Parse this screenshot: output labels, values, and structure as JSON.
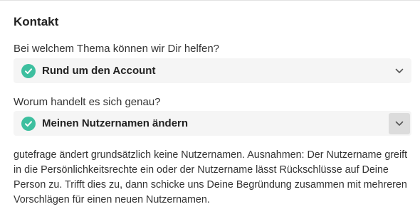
{
  "contact": {
    "title": "Kontakt",
    "topic_label": "Bei welchem Thema können wir Dir helfen?",
    "topic_value": "Rund um den Account",
    "detail_label": "Worum handelt es sich genau?",
    "detail_value": "Meinen Nutzernamen ändern",
    "description": "gutefrage ändert grundsätzlich keine Nutzernamen. Ausnahmen: Der Nutzername greift in die Persönlichkeitsrechte ein oder der Nutzername lässt Rückschlüsse auf Deine Person zu. Trifft dies zu, dann schicke uns Deine Begründung zusammen mit mehreren Vorschlägen für einen neuen Nutzernamen."
  },
  "icons": {
    "selected": "check-circle-icon",
    "expand": "chevron-down-icon"
  },
  "colors": {
    "accent": "#3dbf9f",
    "select_bg": "#f5f5f5",
    "active_chevron_bg": "#dcdcdc"
  }
}
